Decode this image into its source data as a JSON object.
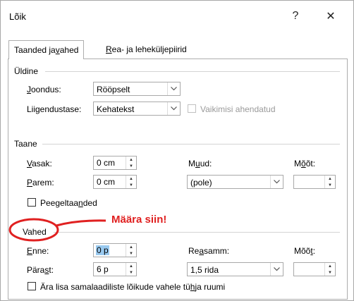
{
  "window": {
    "title": "Lõik",
    "help_label": "?",
    "close_label": "✕"
  },
  "tabs": [
    {
      "label_pre": "Taanded ja ",
      "label_u": "v",
      "label_post": "ahed"
    },
    {
      "label_pre": "",
      "label_u": "R",
      "label_post": "ea- ja leheküljepiirid"
    }
  ],
  "general": {
    "title": "Üldine",
    "alignment_label_u": "J",
    "alignment_label_post": "oondus:",
    "alignment_value": "Rööpselt",
    "outline_label": "Liigendustase:",
    "outline_value": "Kehatekst",
    "collapsed_label": "Vaikimisi ahendatud"
  },
  "indent": {
    "title": "Taane",
    "left_label_u": "V",
    "left_label_post": "asak:",
    "left_value": "0 cm",
    "right_label_u": "P",
    "right_label_post": "arem:",
    "right_value": "0 cm",
    "special_label_pre": "M",
    "special_label_u": "u",
    "special_label_post": "ud:",
    "special_value": "(pole)",
    "by_label_pre": "M",
    "by_label_u": "õ",
    "by_label_post": "õt:",
    "mirror_label_pre": "Peegeltaa",
    "mirror_label_u": "n",
    "mirror_label_post": "ded"
  },
  "spacing": {
    "title": "Vahed",
    "before_label_u": "E",
    "before_label_post": "nne:",
    "before_value": "0 p",
    "after_label_pre": "Pära",
    "after_label_u": "s",
    "after_label_post": "t:",
    "after_value": "6 p",
    "line_label_pre": "Re",
    "line_label_u": "a",
    "line_label_post": "samm:",
    "line_value": "1,5 rida",
    "at_label_pre": "Mõõ",
    "at_label_u": "t",
    "at_label_post": ":",
    "no_space_label_pre": "Ära lisa samalaadiliste lõikude vahele tü",
    "no_space_label_u": "h",
    "no_space_label_post": "ja ruumi"
  },
  "annotation": {
    "text": "Määra siin!",
    "color": "#e02020"
  }
}
